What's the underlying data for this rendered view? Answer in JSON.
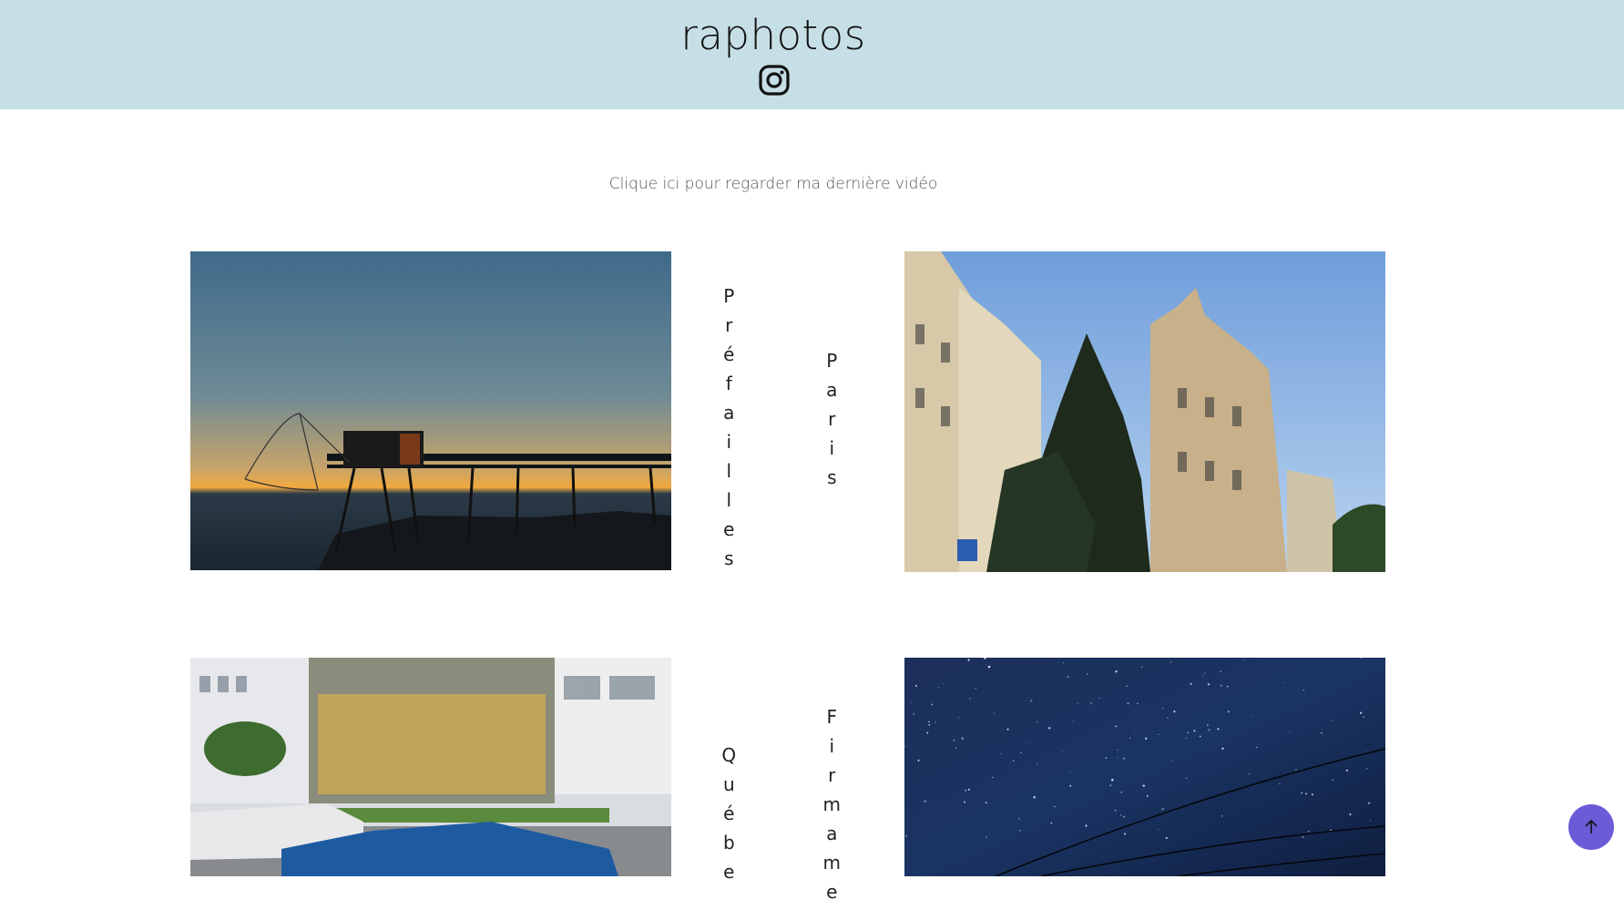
{
  "header": {
    "site_title": "raphotos",
    "instagram_icon": "instagram-icon"
  },
  "main": {
    "video_link": "Clique ici pour regarder ma dernière vidéo",
    "galleries": [
      {
        "label": "Préfailles"
      },
      {
        "label": "Paris"
      },
      {
        "label": "Québe"
      },
      {
        "label": "Firmame"
      }
    ]
  },
  "scroll_top": {
    "icon": "arrow-up-icon",
    "color": "#6b5bd6"
  },
  "colors": {
    "header_bg": "#c6dfe6",
    "page_bg": "#ffffff"
  }
}
